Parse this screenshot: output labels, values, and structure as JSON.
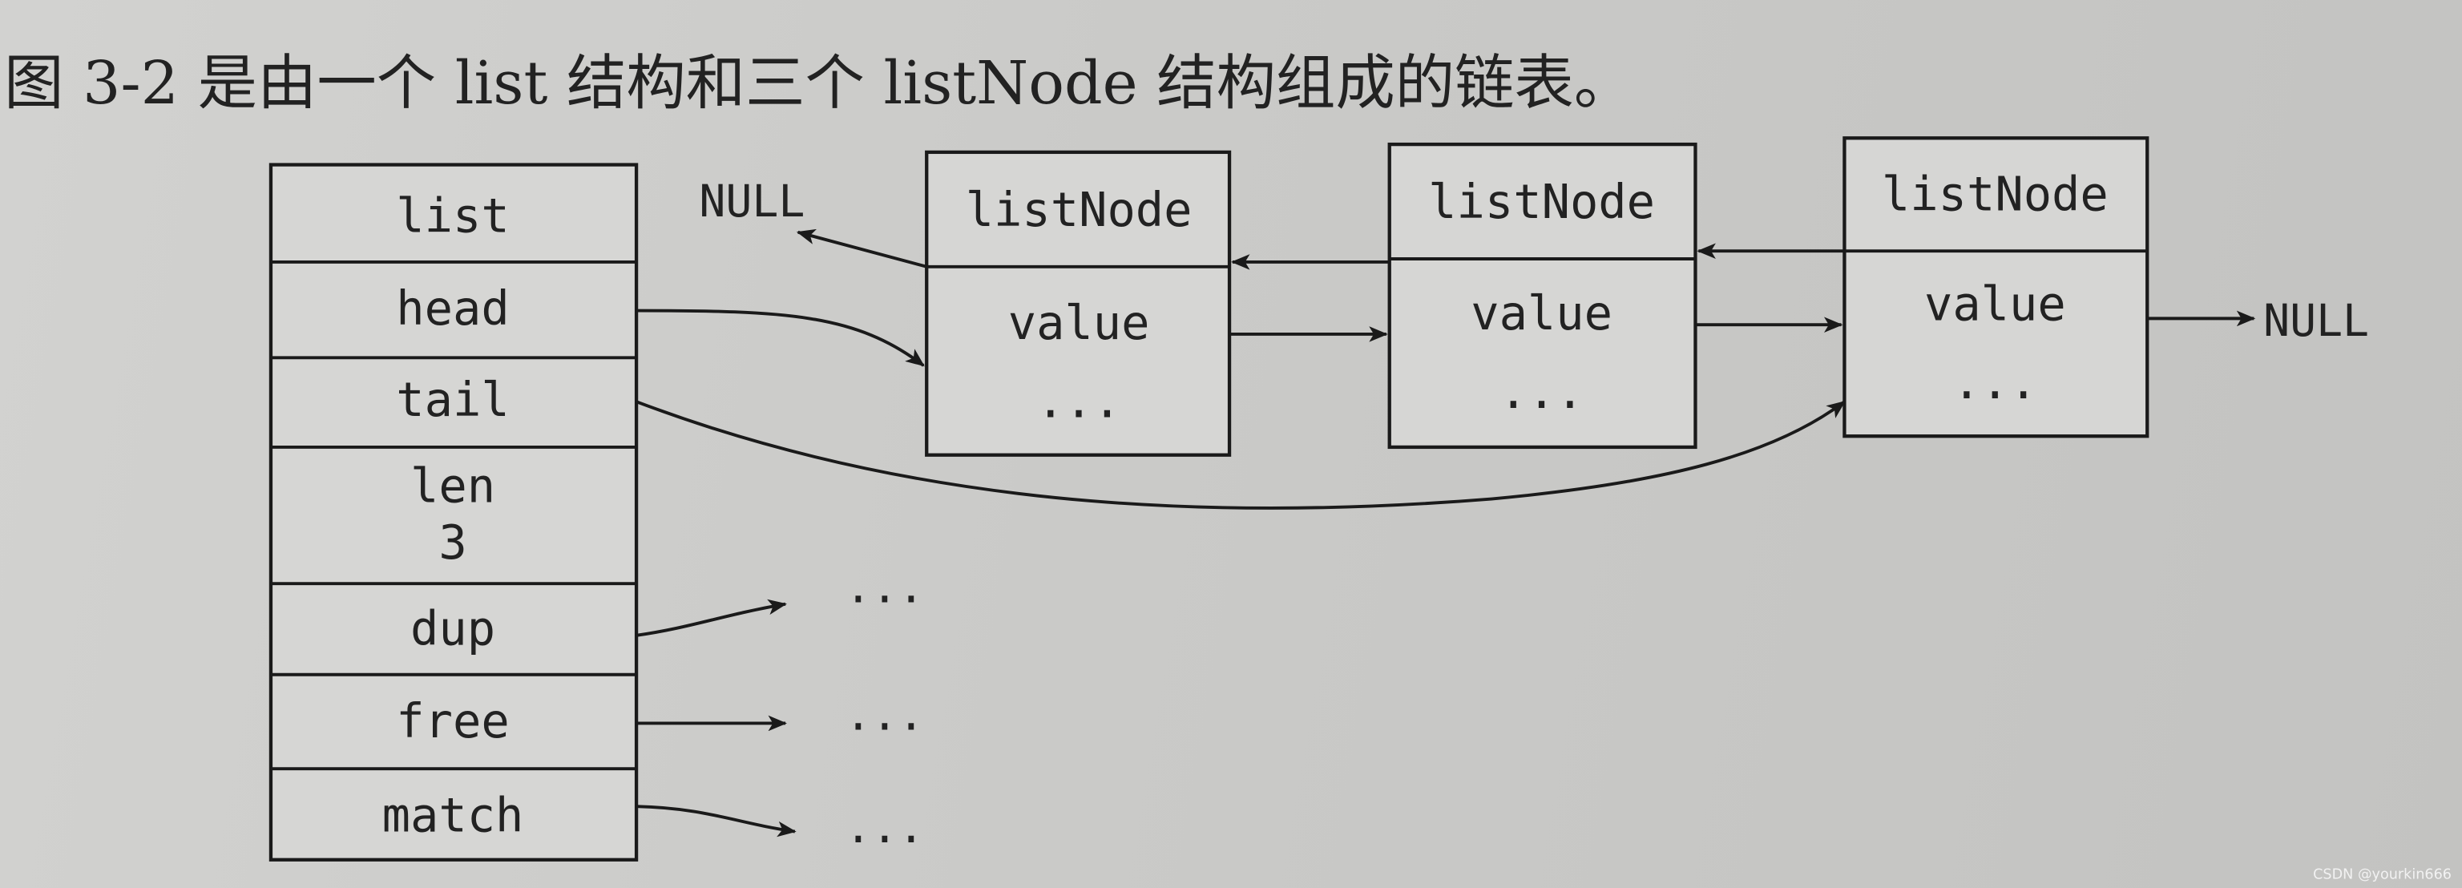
{
  "caption": "图 3-2 是由一个 list 结构和三个 listNode 结构组成的链表。",
  "list_struct": {
    "title": "list",
    "fields": [
      "head",
      "tail",
      "len",
      "dup",
      "free",
      "match"
    ],
    "len_value": "3"
  },
  "nodes": [
    {
      "title": "listNode",
      "value": "value",
      "more": "..."
    },
    {
      "title": "listNode",
      "value": "value",
      "more": "..."
    },
    {
      "title": "listNode",
      "value": "value",
      "more": "..."
    }
  ],
  "null_label": "NULL",
  "ellipsis": "...",
  "watermark": "CSDN @yourkin666"
}
